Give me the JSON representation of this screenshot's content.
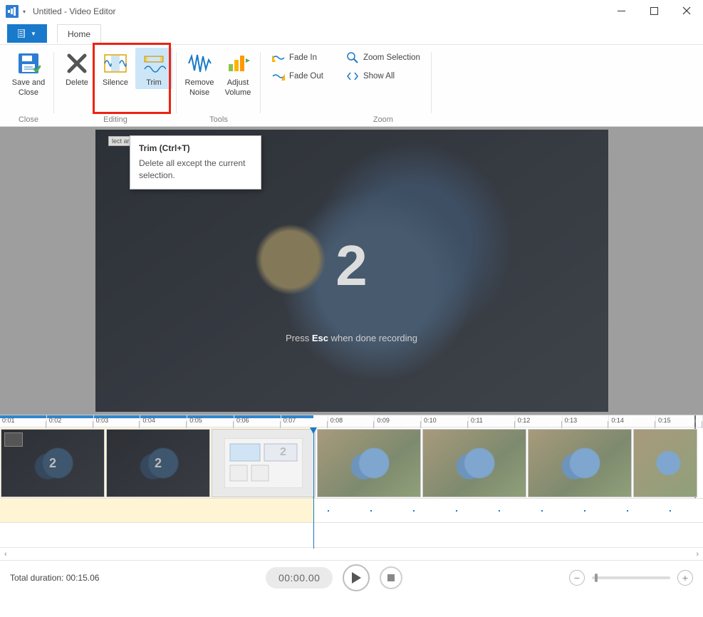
{
  "titlebar": {
    "title": "Untitled - Video Editor"
  },
  "ribbon_tab": {
    "home": "Home"
  },
  "ribbon": {
    "close": {
      "save_and_close": "Save and\nClose",
      "group": "Close"
    },
    "editing": {
      "delete": "Delete",
      "silence": "Silence",
      "trim": "Trim",
      "group": "Editing"
    },
    "tools": {
      "remove_noise": "Remove\nNoise",
      "adjust_volume": "Adjust\nVolume",
      "group": "Tools"
    },
    "fade": {
      "fade_in": "Fade In",
      "fade_out": "Fade Out"
    },
    "zoom": {
      "zoom_selection": "Zoom Selection",
      "show_all": "Show All",
      "group": "Zoom"
    }
  },
  "tooltip": {
    "title": "Trim (Ctrl+T)",
    "body": "Delete all except the current selection."
  },
  "select_area_label": "lect area",
  "preview": {
    "countdown": "2",
    "hint_prefix": "Press ",
    "hint_key": "Esc",
    "hint_suffix": " when done recording"
  },
  "ruler": [
    "0:01",
    "0:02",
    "0:03",
    "0:04",
    "0:05",
    "0:06",
    "0:07",
    "0:08",
    "0:09",
    "0:10",
    "0:11",
    "0:12",
    "0:13",
    "0:14",
    "0:15"
  ],
  "status": {
    "total_label": "Total duration: ",
    "total_value": "00:15.06",
    "current_time": "00:00.00"
  }
}
